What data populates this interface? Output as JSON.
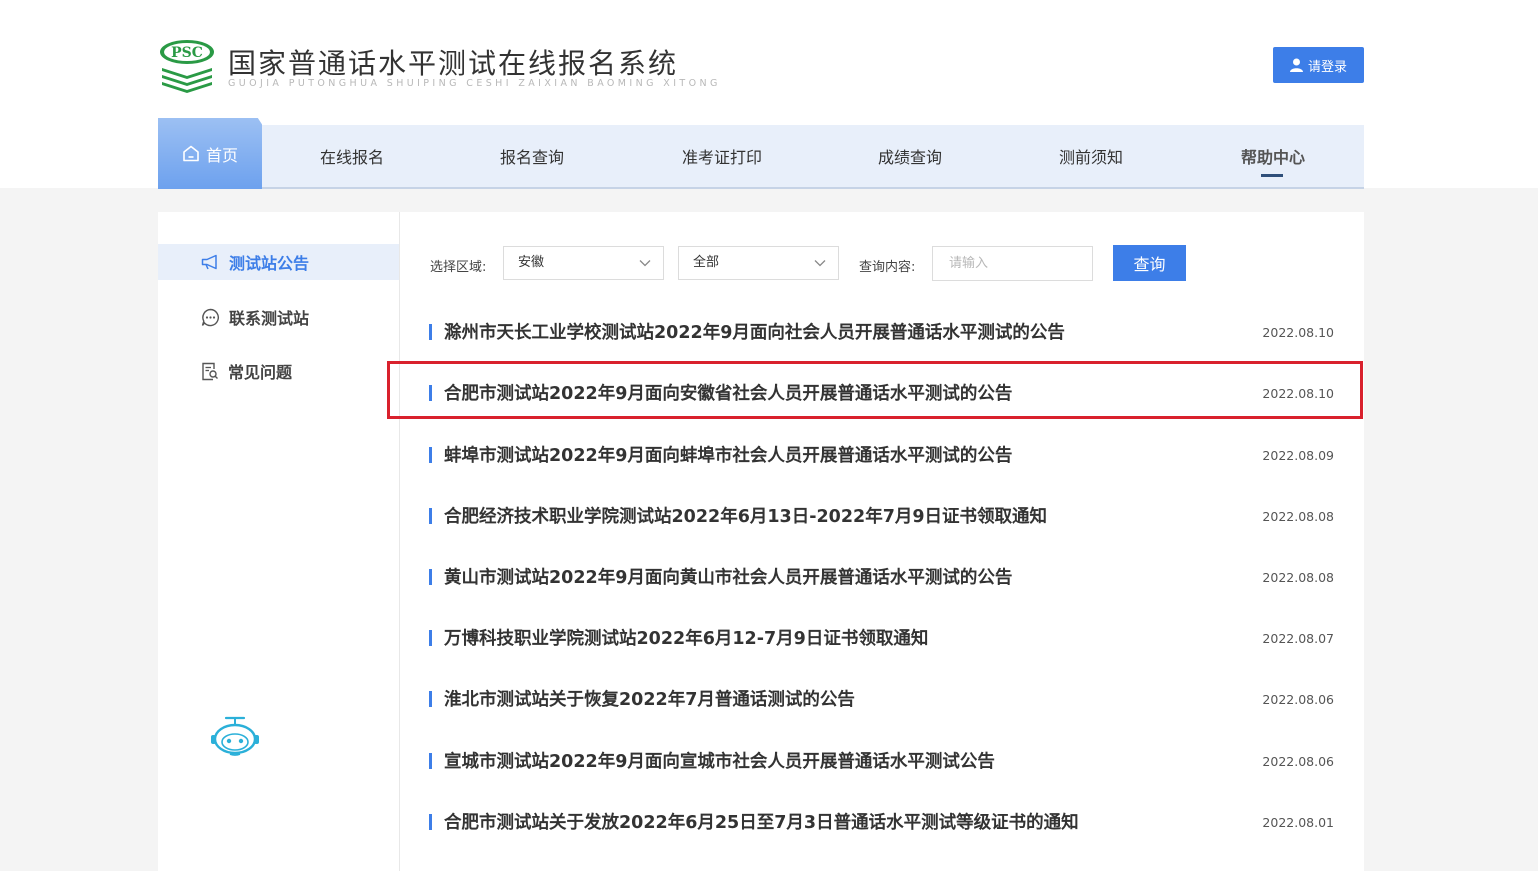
{
  "header": {
    "logo_badge": "PSC",
    "title": "国家普通话水平测试在线报名系统",
    "pinyin": "GUOJIA PUTONGHUA SHUIPING CESHI ZAIXIAN BAOMING XITONG",
    "login_label": "请登录"
  },
  "nav": {
    "items": [
      {
        "label": "首页",
        "icon": "home-icon"
      },
      {
        "label": "在线报名"
      },
      {
        "label": "报名查询"
      },
      {
        "label": "准考证打印"
      },
      {
        "label": "成绩查询"
      },
      {
        "label": "测前须知"
      },
      {
        "label": "帮助中心"
      }
    ]
  },
  "sidebar": {
    "items": [
      {
        "label": "测试站公告",
        "icon": "megaphone-icon"
      },
      {
        "label": "联系测试站",
        "icon": "chat-icon"
      },
      {
        "label": "常见问题",
        "icon": "document-search-icon"
      }
    ]
  },
  "filter": {
    "region_label": "选择区域:",
    "region_value": "安徽",
    "scope_value": "全部",
    "query_label": "查询内容:",
    "query_placeholder": "请输入",
    "query_button": "查询"
  },
  "announcements": [
    {
      "title": "滁州市天长工业学校测试站2022年9月面向社会人员开展普通话水平测试的公告",
      "date": "2022.08.10"
    },
    {
      "title": "合肥市测试站2022年9月面向安徽省社会人员开展普通话水平测试的公告",
      "date": "2022.08.10"
    },
    {
      "title": "蚌埠市测试站2022年9月面向蚌埠市社会人员开展普通话水平测试的公告",
      "date": "2022.08.09"
    },
    {
      "title": "合肥经济技术职业学院测试站2022年6月13日-2022年7月9日证书领取通知",
      "date": "2022.08.08"
    },
    {
      "title": "黄山市测试站2022年9月面向黄山市社会人员开展普通话水平测试的公告",
      "date": "2022.08.08"
    },
    {
      "title": "万博科技职业学院测试站2022年6月12-7月9日证书领取通知",
      "date": "2022.08.07"
    },
    {
      "title": "淮北市测试站关于恢复2022年7月普通话测试的公告",
      "date": "2022.08.06"
    },
    {
      "title": "宣城市测试站2022年9月面向宣城市社会人员开展普通话水平测试公告",
      "date": "2022.08.06"
    },
    {
      "title": "合肥市测试站关于发放2022年6月25日至7月3日普通话水平测试等级证书的通知",
      "date": "2022.08.01"
    }
  ],
  "colors": {
    "accent": "#3d7ee8",
    "highlight": "#d9212d",
    "logo_green": "#2a9a45"
  }
}
